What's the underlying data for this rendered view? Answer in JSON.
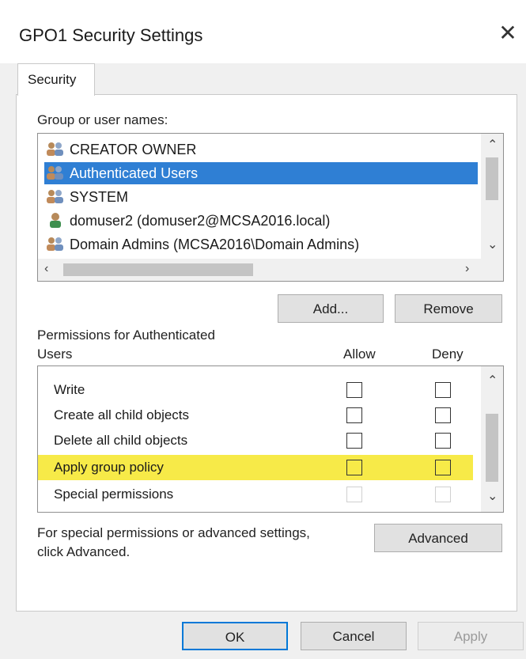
{
  "dialog": {
    "title": "GPO1 Security Settings",
    "close_glyph": "✕"
  },
  "tabs": [
    {
      "label": "Security"
    }
  ],
  "group_label": "Group or user names:",
  "users": [
    {
      "name": "CREATOR OWNER",
      "icon": "group-icon",
      "selected": false
    },
    {
      "name": "Authenticated Users",
      "icon": "group-icon",
      "selected": true
    },
    {
      "name": "SYSTEM",
      "icon": "group-icon",
      "selected": false
    },
    {
      "name": "domuser2 (domuser2@MCSA2016.local)",
      "icon": "user-icon",
      "selected": false
    },
    {
      "name": "Domain Admins (MCSA2016\\Domain Admins)",
      "icon": "group-icon",
      "selected": false
    }
  ],
  "buttons": {
    "add": "Add...",
    "remove": "Remove",
    "advanced": "Advanced",
    "ok": "OK",
    "cancel": "Cancel",
    "apply": "Apply"
  },
  "permissions": {
    "label_line1": "Permissions for Authenticated",
    "label_line2": "Users",
    "col_allow": "Allow",
    "col_deny": "Deny",
    "rows": [
      {
        "name": "Write",
        "allow": false,
        "deny": false,
        "highlighted": false,
        "disabled": false
      },
      {
        "name": "Create all child objects",
        "allow": false,
        "deny": false,
        "highlighted": false,
        "disabled": false
      },
      {
        "name": "Delete all child objects",
        "allow": false,
        "deny": false,
        "highlighted": false,
        "disabled": false
      },
      {
        "name": "Apply group policy",
        "allow": false,
        "deny": false,
        "highlighted": true,
        "disabled": false
      },
      {
        "name": "Special permissions",
        "allow": false,
        "deny": false,
        "highlighted": false,
        "disabled": true
      }
    ]
  },
  "advanced_note": {
    "line1": "For special permissions or advanced settings,",
    "line2": "click Advanced."
  },
  "colors": {
    "selection": "#2f7fd4",
    "highlight": "#f7ea48",
    "default_button_border": "#0078d7"
  }
}
